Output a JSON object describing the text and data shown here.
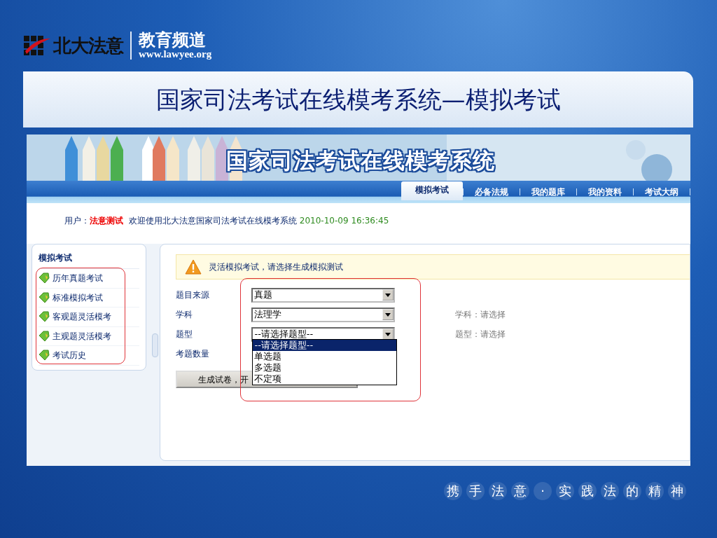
{
  "logo": {
    "brand": "北大法意",
    "channel": "教育频道",
    "url": "www.lawyee.org"
  },
  "slide_title": "国家司法考试在线模考系统—模拟考试",
  "site": {
    "banner_title": "国家司法考试在线模考系统",
    "tabs": [
      {
        "label": "模拟考试",
        "selected": true
      },
      {
        "label": "必备法规",
        "selected": false
      },
      {
        "label": "我的题库",
        "selected": false
      },
      {
        "label": "我的资料",
        "selected": false
      },
      {
        "label": "考试大纲",
        "selected": false
      }
    ],
    "user_line": {
      "label": "用户：",
      "user": "法意测试",
      "welcome": "欢迎使用北大法意国家司法考试在线模考系统",
      "datetime": "2010-10-09 16:36:45"
    },
    "sidebar": {
      "heading": "模拟考试",
      "items": [
        {
          "label": "历年真题考试"
        },
        {
          "label": "标准模拟考试"
        },
        {
          "label": "客观题灵活模考"
        },
        {
          "label": "主观题灵活模考"
        },
        {
          "label": "考试历史"
        }
      ]
    },
    "notice": "灵活模拟考试，请选择生成模拟测试",
    "form": [
      {
        "label": "题目来源",
        "value": "真题"
      },
      {
        "label": "学科",
        "value": "法理学",
        "hint": "学科：请选择"
      },
      {
        "label": "题型",
        "value": "--请选择题型--",
        "hint": "题型：请选择"
      },
      {
        "label": "考题数量"
      }
    ],
    "dropdown_options": [
      {
        "label": "--请选择题型--",
        "selected": true
      },
      {
        "label": "单选题",
        "selected": false
      },
      {
        "label": "多选题",
        "selected": false
      },
      {
        "label": "不定项",
        "selected": false
      }
    ],
    "submit_button": "生成试卷，开"
  },
  "tagline": [
    "携",
    "手",
    "法",
    "意",
    "·",
    "实",
    "践",
    "法",
    "的",
    "精",
    "神"
  ]
}
